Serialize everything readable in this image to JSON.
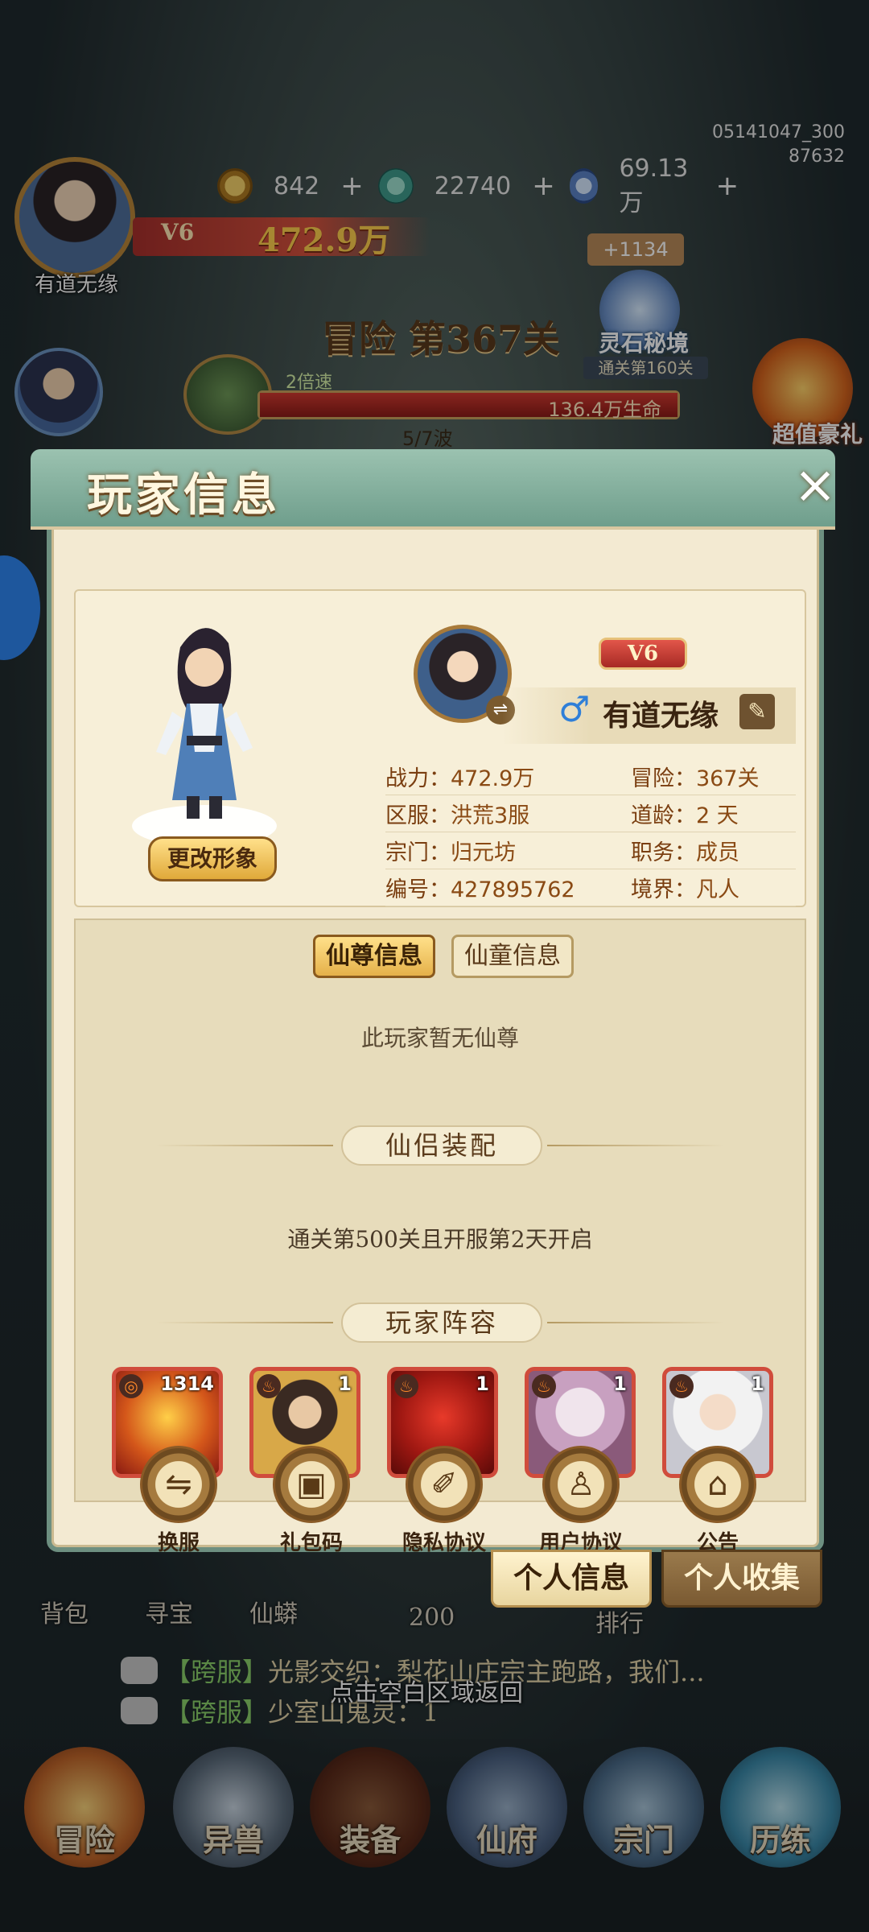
{
  "hud": {
    "version_line1": "05141047_300",
    "version_line2": "87632",
    "player_name": "有道无缘",
    "vip": "V6",
    "power": "472.9万",
    "currency_coin": "842",
    "currency_jade": "22740",
    "currency_gem": "69.13万",
    "plus": "+",
    "stage_title": "冒险 第367关",
    "speed": "2倍速",
    "hp_text": "136.4万生命",
    "wave": "5/7波",
    "bonus": "+1134",
    "lingshi_label": "灵石秘境",
    "lingshi_sub": "通关第160关",
    "gift_label": "超值豪礼"
  },
  "dialog": {
    "title": "玩家信息",
    "close": "×",
    "change_look": "更改形象",
    "vip": "V6",
    "gender": "♂",
    "name": "有道无缘",
    "edit_icon": "✎",
    "swap_icon": "⇌",
    "stats": [
      {
        "k": "战力：",
        "v": "472.9万",
        "k2": "冒险：",
        "v2": "367关"
      },
      {
        "k": "区服：",
        "v": "洪荒3服",
        "k2": "道龄：",
        "v2": "2 天"
      },
      {
        "k": "宗门：",
        "v": "归元坊",
        "k2": "职务：",
        "v2": "成员"
      },
      {
        "k": "编号：",
        "v": "427895762",
        "k2": "境界：",
        "v2": "凡人"
      }
    ],
    "tabs": [
      "仙尊信息",
      "仙童信息"
    ],
    "empty_msg": "此玩家暂无仙尊",
    "section_partner": "仙侣装配",
    "unlock_msg": "通关第500关且开服第2天开启",
    "section_lineup": "玩家阵容",
    "heroes": [
      {
        "level": "1314",
        "stars": "●●",
        "elem": "◎"
      },
      {
        "level": "1",
        "stars": "",
        "elem": "♨"
      },
      {
        "level": "1",
        "stars": "●●●",
        "elem": "♨"
      },
      {
        "level": "1",
        "stars": "●●●",
        "elem": "♨"
      },
      {
        "level": "1",
        "stars": "●●●",
        "elem": "♨"
      }
    ],
    "actions": [
      {
        "label": "换服",
        "icon": "⇋"
      },
      {
        "label": "礼包码",
        "icon": "▣"
      },
      {
        "label": "隐私协议",
        "icon": "✐"
      },
      {
        "label": "用户协议",
        "icon": "♙"
      },
      {
        "label": "公告",
        "icon": "⌂"
      }
    ]
  },
  "bottom_tabs": {
    "personal_info": "个人信息",
    "collection": "个人收集"
  },
  "background": {
    "bag": "背包",
    "treasure": "寻宝",
    "pet": "仙蟒",
    "count": "200",
    "rank": "排行",
    "chat1_tag": "【跨服】",
    "chat1_text": "光影交织：梨花山庄宗主跑路，我们...",
    "chat2_tag": "【跨服】",
    "chat2_text": "少室山鬼灵：1",
    "return_hint": "点击空白区域返回",
    "nav": [
      "冒险",
      "异兽",
      "装备",
      "仙府",
      "宗门",
      "历练"
    ]
  }
}
